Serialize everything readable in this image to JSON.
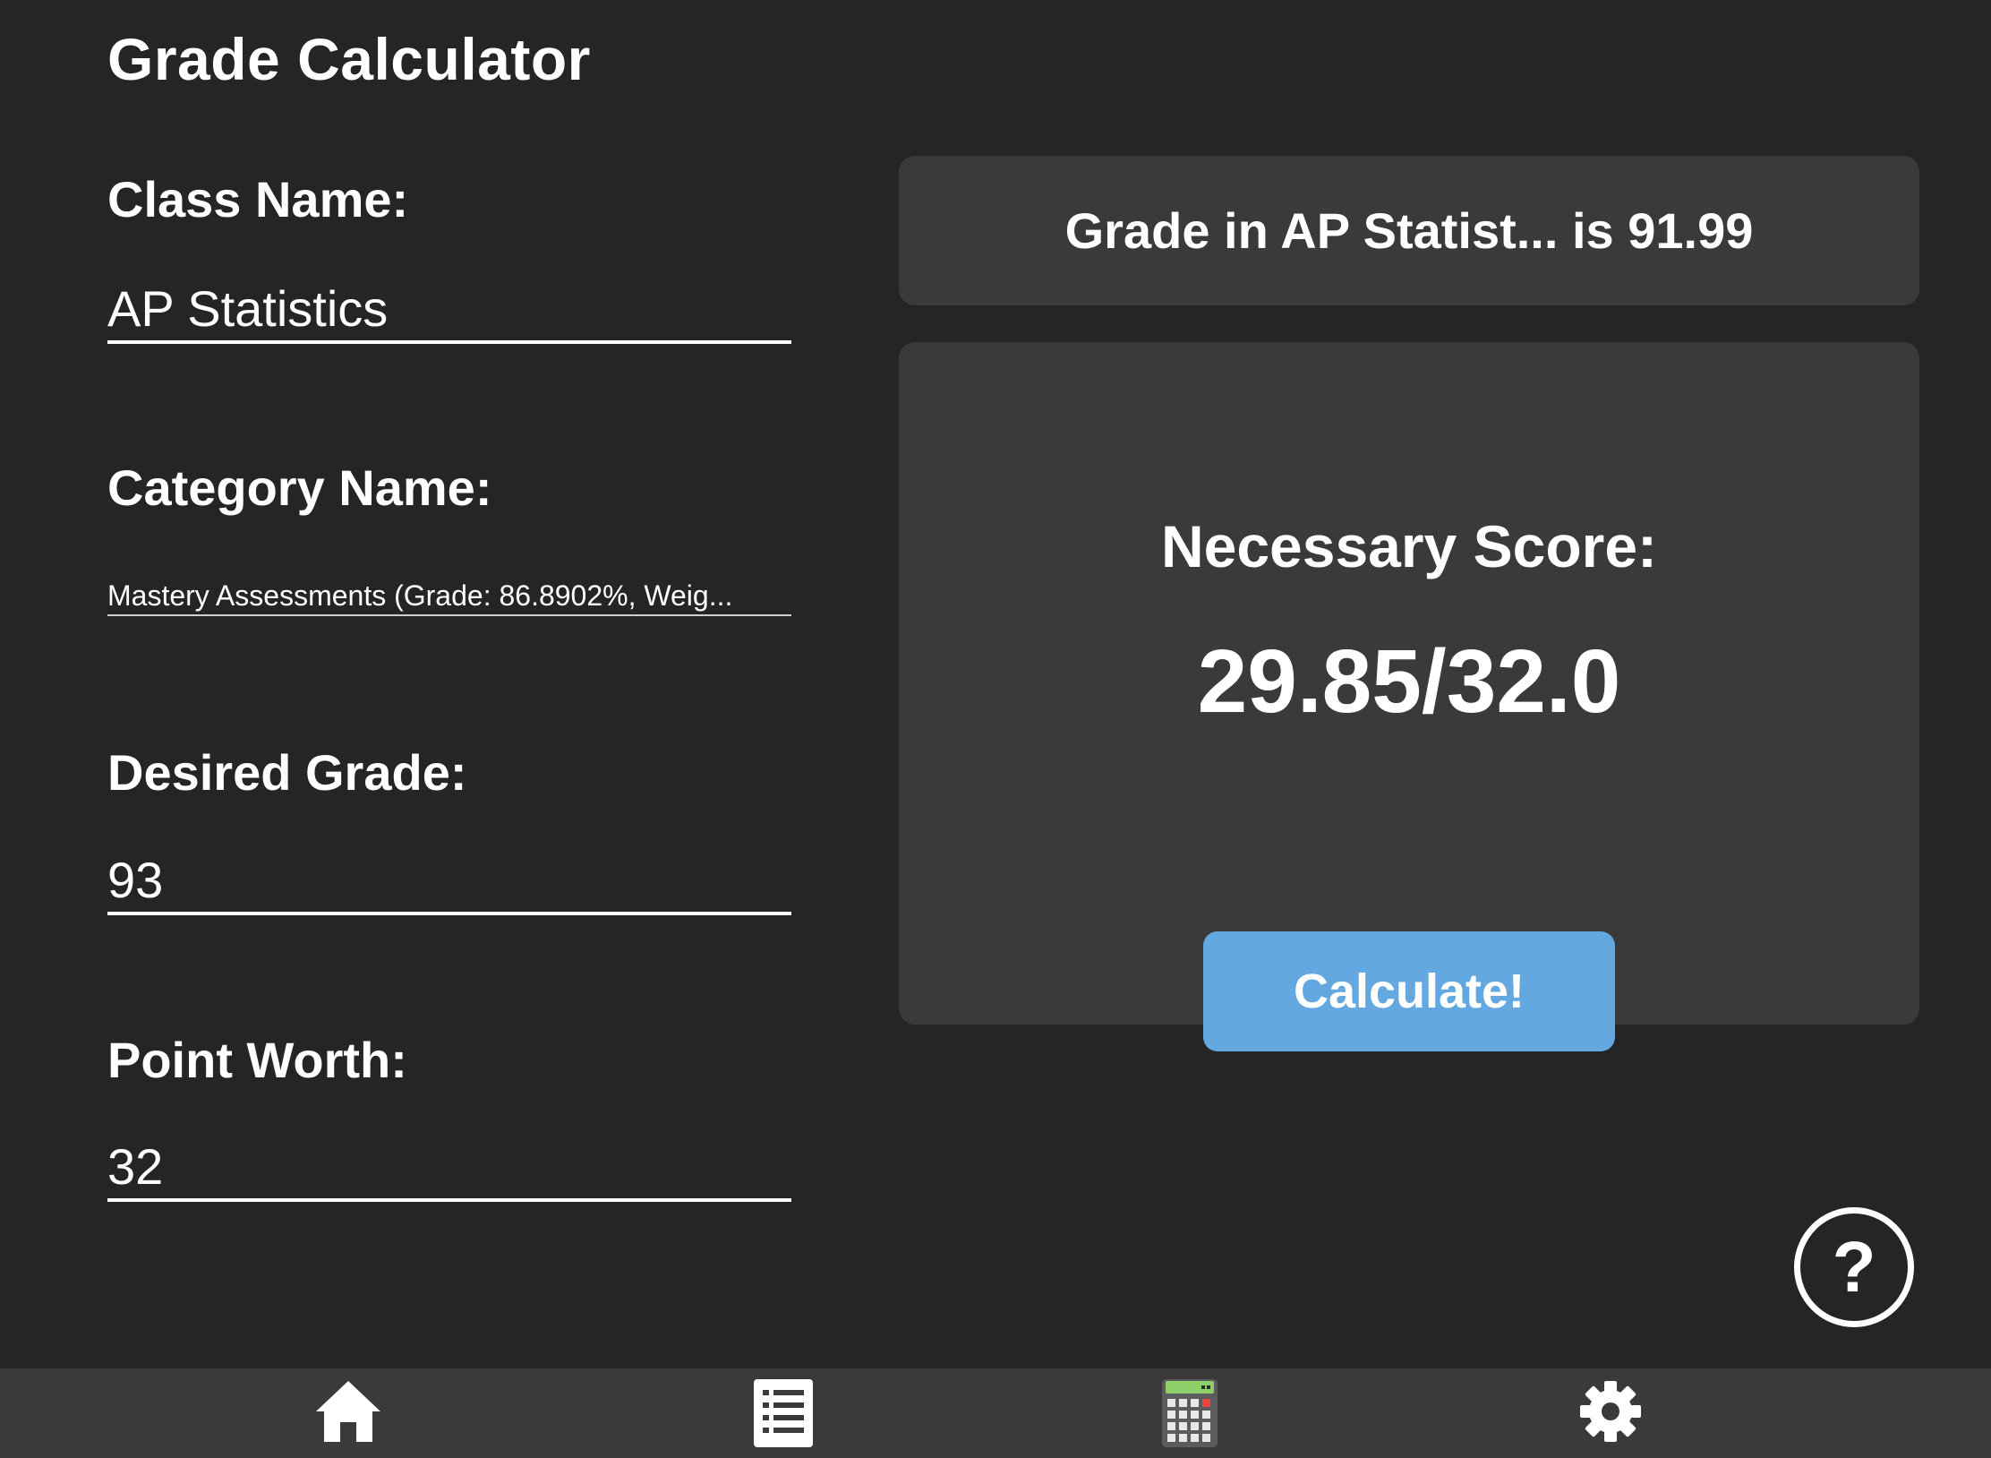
{
  "header": {
    "title": "Grade Calculator"
  },
  "form": {
    "class_name_label": "Class Name:",
    "class_name_value": "AP Statistics",
    "category_label": "Category Name:",
    "category_value": "Mastery Assessments (Grade: 86.8902%, Weig...",
    "desired_grade_label": "Desired Grade:",
    "desired_grade_value": "93",
    "point_worth_label": "Point Worth:",
    "point_worth_value": "32"
  },
  "result": {
    "grade_text": "Grade in AP Statist... is 91.99",
    "necessary_label": "Necessary Score:",
    "necessary_value": "29.85/32.0",
    "calculate_label": "Calculate!"
  },
  "help": {
    "label": "?"
  },
  "tabbar": {
    "items": [
      {
        "icon": "home-icon"
      },
      {
        "icon": "list-icon"
      },
      {
        "icon": "calculator-icon"
      },
      {
        "icon": "gear-icon"
      }
    ]
  },
  "colors": {
    "background": "#252527",
    "card": "#3a3a3c",
    "accent": "#63a8e0"
  }
}
